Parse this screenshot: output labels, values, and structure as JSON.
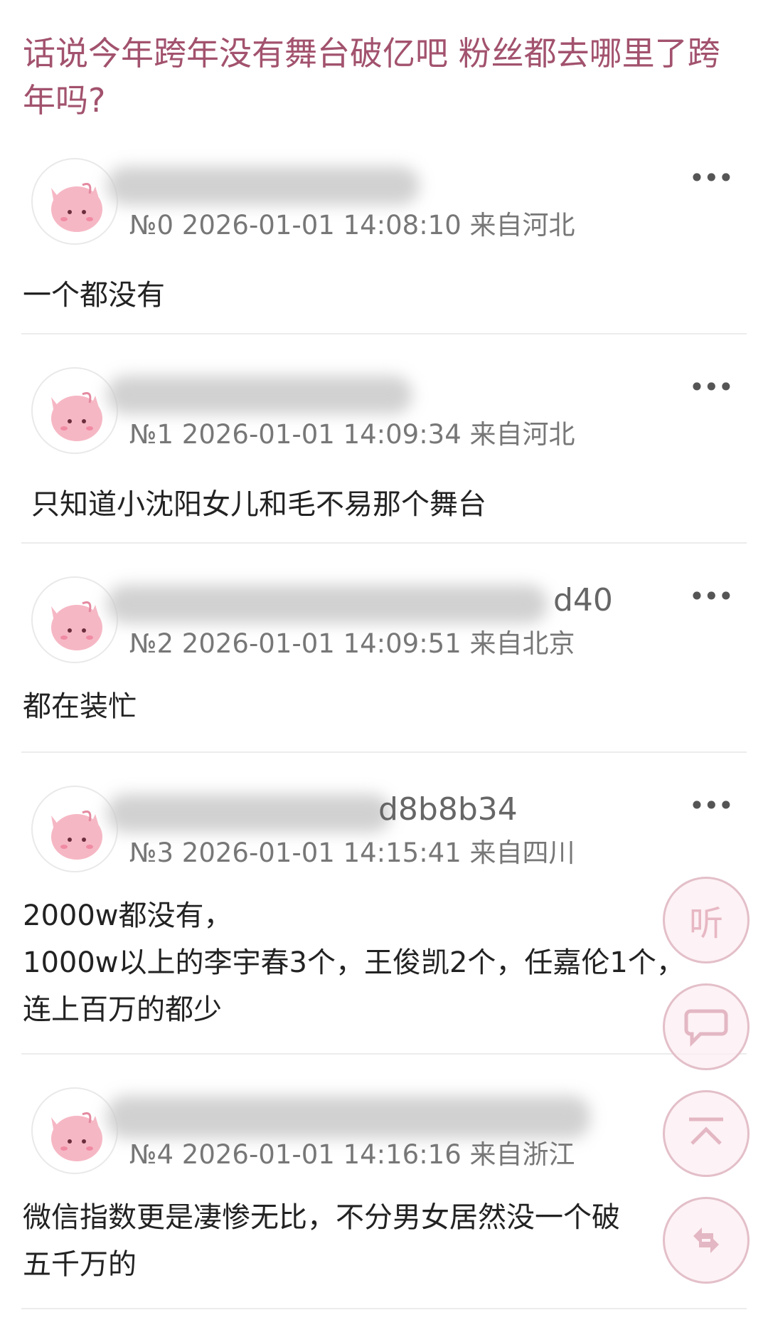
{
  "thread": {
    "title": "话说今年跨年没有舞台破亿吧 粉丝都去哪里了跨年吗?"
  },
  "posts": [
    {
      "name_suffix": "",
      "meta": "№0 2026-01-01 14:08:10 来自河北",
      "content": "一个都没有"
    },
    {
      "name_suffix": "",
      "meta": "№1 2026-01-01 14:09:34 来自河北",
      "content": "只知道小沈阳女儿和毛不易那个舞台"
    },
    {
      "name_suffix": "d40",
      "meta": "№2 2026-01-01 14:09:51 来自北京",
      "content": "都在装忙"
    },
    {
      "name_suffix": "d8b8b34",
      "meta": "№3 2026-01-01 14:15:41 来自四川",
      "content": "2000w都没有，\n1000w以上的李宇春3个，王俊凯2个，任嘉伦1个，\n连上百万的都少"
    },
    {
      "name_suffix": "",
      "meta": "№4 2026-01-01 14:16:16 来自浙江",
      "content": "微信指数更是凄惨无比，不分男女居然没一个破\n五千万的"
    }
  ],
  "more_label": "•••",
  "fab": {
    "listen_label": "听"
  }
}
